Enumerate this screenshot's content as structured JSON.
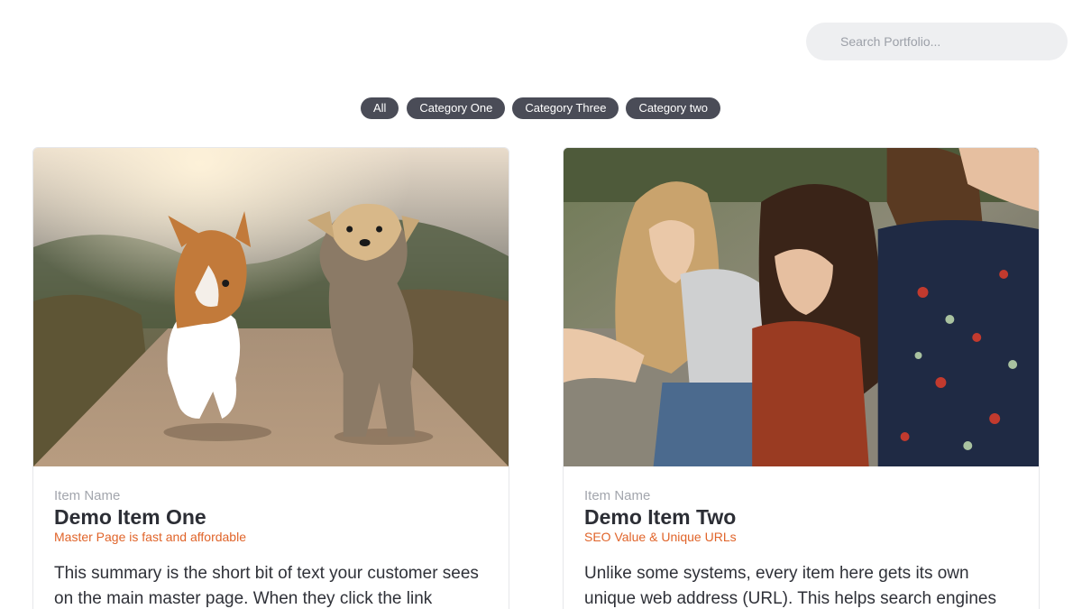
{
  "search": {
    "placeholder": "Search Portfolio..."
  },
  "filters": [
    {
      "label": "All"
    },
    {
      "label": "Category One"
    },
    {
      "label": "Category Three"
    },
    {
      "label": "Category two"
    }
  ],
  "items": [
    {
      "eyebrow": "Item Name",
      "title": "Demo Item One",
      "subtitle": "Master Page is fast and affordable",
      "summary": "This summary is the short bit of text your customer sees on the main master page. When they click the link",
      "image": "dogs-running-photo"
    },
    {
      "eyebrow": "Item Name",
      "title": "Demo Item Two",
      "subtitle": "SEO Value & Unique URLs",
      "summary": "Unlike some systems, every item here gets its own unique web address (URL). This helps search engines",
      "image": "friends-laughing-photo"
    }
  ],
  "colors": {
    "pill_bg": "#4a4c57",
    "accent": "#e0642a",
    "search_bg": "#eeeff1"
  }
}
